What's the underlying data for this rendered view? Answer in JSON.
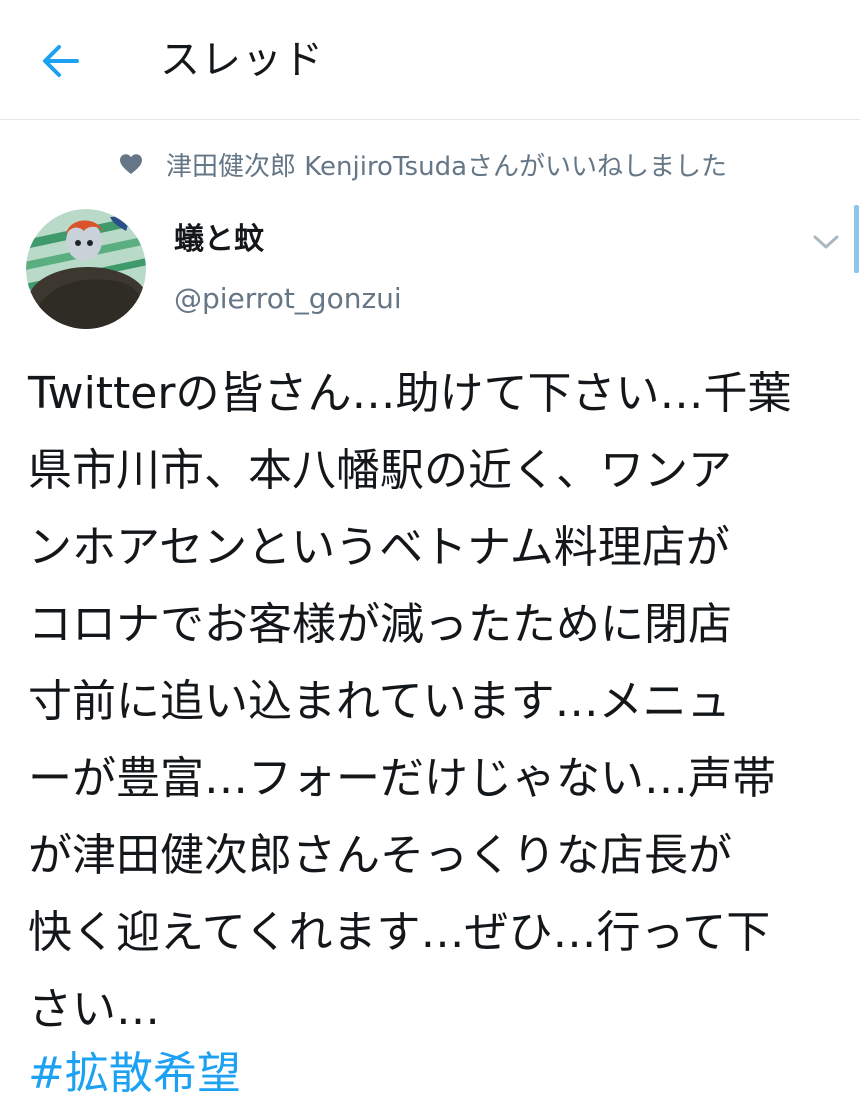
{
  "header": {
    "title": "スレッド"
  },
  "social_context": {
    "text": "津田健次郎 KenjiroTsudaさんがいいねしました"
  },
  "author": {
    "display_name": "蟻と蚊",
    "handle": "@pierrot_gonzui"
  },
  "tweet": {
    "text": "Twitterの皆さん…助けて下さい…千葉\n県市川市、本八幡駅の近く、ワンア\nンホアセンというベトナム料理店が\nコロナでお客様が減ったために閉店\n寸前に追い込まれています…メニュ\nーが豊富…フォーだけじゃない…声帯\nが津田健次郎さんそっくりな店長が\n快く迎えてくれます…ぜひ…行って下\nさい…",
    "hashtag": "#拡散希望"
  },
  "icons": {
    "back": "arrow-left-icon",
    "like": "heart-icon",
    "more": "chevron-down-icon"
  },
  "colors": {
    "accent": "#1da1f2",
    "secondary_text": "#657786",
    "primary_text": "#14171a"
  }
}
